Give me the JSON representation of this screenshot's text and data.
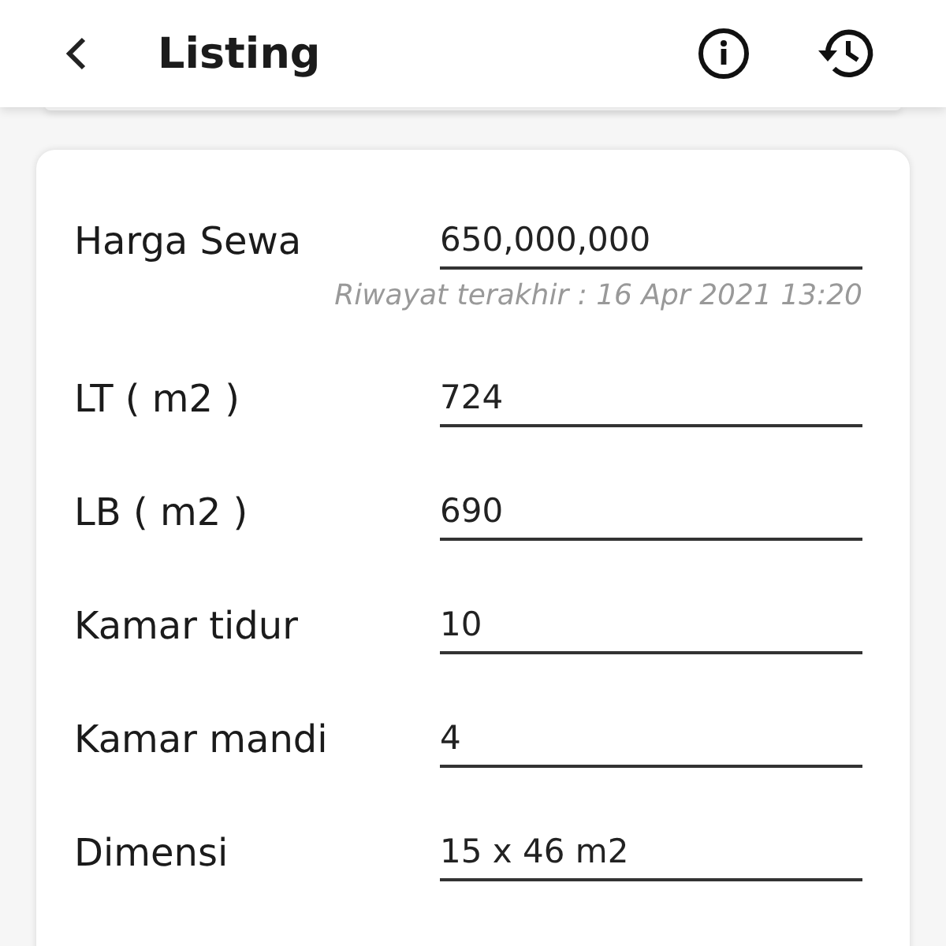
{
  "header": {
    "title": "Listing"
  },
  "fields": [
    {
      "label": "Harga Sewa",
      "value": "650,000,000",
      "note": "Riwayat terakhir : 16 Apr 2021 13:20"
    },
    {
      "label": "LT ( m2 )",
      "value": "724"
    },
    {
      "label": "LB ( m2 )",
      "value": "690"
    },
    {
      "label": "Kamar tidur",
      "value": "10"
    },
    {
      "label": "Kamar mandi",
      "value": "4"
    },
    {
      "label": "Dimensi",
      "value": "15 x 46 m2"
    }
  ]
}
